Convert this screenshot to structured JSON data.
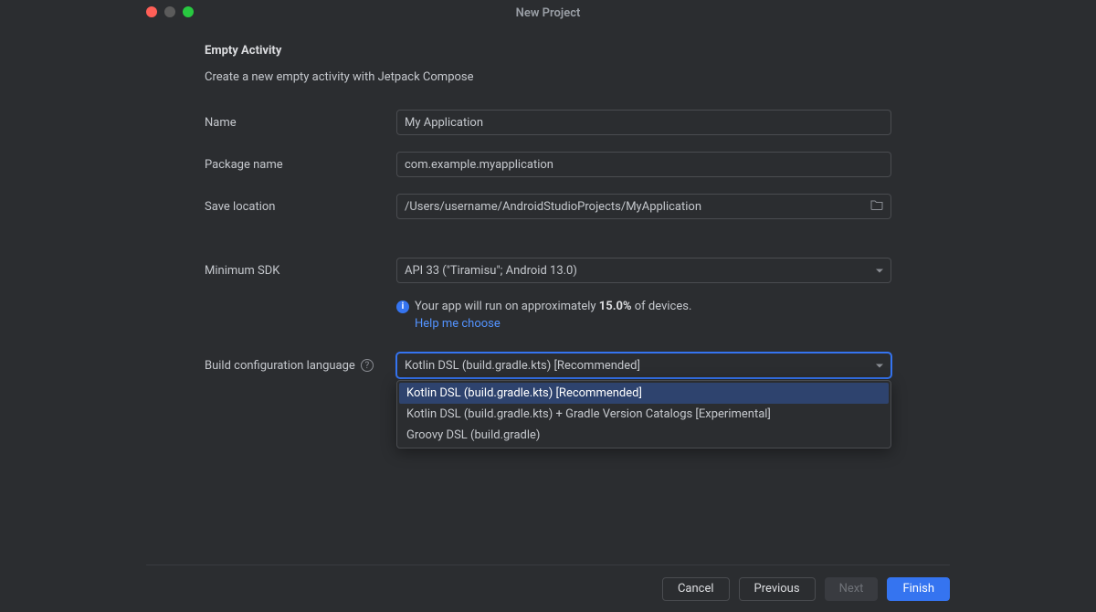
{
  "window": {
    "title": "New Project"
  },
  "page": {
    "heading": "Empty Activity",
    "subheading": "Create a new empty activity with Jetpack Compose"
  },
  "form": {
    "name_label": "Name",
    "name_value": "My Application",
    "package_label": "Package name",
    "package_value": "com.example.myapplication",
    "save_label": "Save location",
    "save_value": "/Users/username/AndroidStudioProjects/MyApplication",
    "minsdk_label": "Minimum SDK",
    "minsdk_value": "API 33 (\"Tiramisu\"; Android 13.0)",
    "build_label": "Build configuration language",
    "build_value": "Kotlin DSL (build.gradle.kts) [Recommended]"
  },
  "info": {
    "prefix": "Your app will run on approximately ",
    "percent": "15.0%",
    "suffix": " of devices.",
    "help_link": "Help me choose"
  },
  "dropdown": {
    "items": [
      "Kotlin DSL (build.gradle.kts) [Recommended]",
      "Kotlin DSL (build.gradle.kts) + Gradle Version Catalogs [Experimental]",
      "Groovy DSL (build.gradle)"
    ]
  },
  "footer": {
    "cancel": "Cancel",
    "previous": "Previous",
    "next": "Next",
    "finish": "Finish"
  }
}
